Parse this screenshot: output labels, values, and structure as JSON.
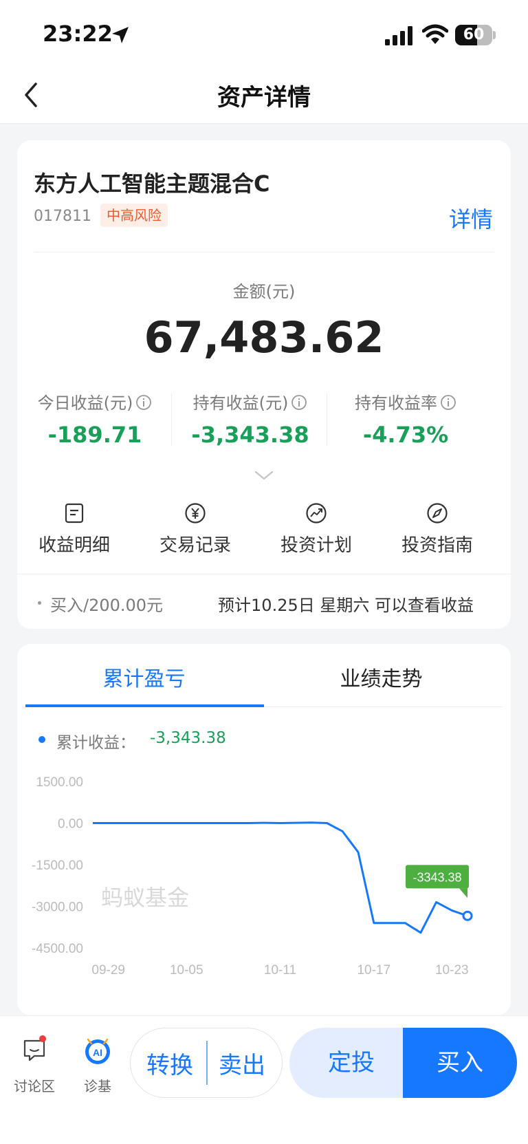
{
  "status": {
    "time": "23:22",
    "battery": "60",
    "battery_level": 0.6
  },
  "nav": {
    "title": "资产详情"
  },
  "fund": {
    "name": "东方人工智能主题混合C",
    "code": "017811",
    "risk": "中高风险",
    "detail_link": "详情",
    "amount_label": "金额(元)",
    "amount": "67,483.62"
  },
  "metrics": [
    {
      "label": "今日收益(元)",
      "value": "-189.71"
    },
    {
      "label": "持有收益(元)",
      "value": "-3,343.38"
    },
    {
      "label": "持有收益率",
      "value": "-4.73%"
    }
  ],
  "quick_actions": [
    {
      "label": "收益明细",
      "icon": "document-icon"
    },
    {
      "label": "交易记录",
      "icon": "yuan-icon"
    },
    {
      "label": "投资计划",
      "icon": "trend-icon"
    },
    {
      "label": "投资指南",
      "icon": "compass-icon"
    }
  ],
  "buy_info": {
    "amount": "买入/200.00元",
    "estimate": "预计10.25日 星期六 可以查看收益"
  },
  "tabs": {
    "active": "累计盈亏",
    "inactive": "业绩走势"
  },
  "legend": {
    "label": "累计收益：",
    "value": "-3,343.38"
  },
  "watermark": "蚂蚁基金",
  "colors": {
    "accent": "#1677ff",
    "loss": "#18a058",
    "risk": "#ee5a2c",
    "tooltip": "#4caf3f"
  },
  "chart_data": {
    "type": "line",
    "y_ticks": [
      "1500.00",
      "0.00",
      "-1500.00",
      "-3000.00",
      "-4500.00"
    ],
    "ylim": [
      -4500,
      1500
    ],
    "x_ticks": [
      {
        "label": "09-29",
        "index": 1
      },
      {
        "label": "10-05",
        "index": 6
      },
      {
        "label": "10-11",
        "index": 12
      },
      {
        "label": "10-17",
        "index": 18
      },
      {
        "label": "10-23",
        "index": 23
      }
    ],
    "values": [
      0,
      0,
      0,
      0,
      0,
      0,
      0,
      0,
      0,
      0,
      0,
      10,
      0,
      10,
      20,
      0,
      -300,
      -1050,
      -3600,
      -3600,
      -3600,
      -3950,
      -2850,
      -3150,
      -3343.38
    ],
    "tooltip": "-3343.38"
  },
  "bottom": {
    "discussion": "讨论区",
    "diagnose": "诊基",
    "ai_badge": "AI",
    "convert": "转换",
    "sell": "卖出",
    "auto_invest": "定投",
    "buy": "买入"
  }
}
